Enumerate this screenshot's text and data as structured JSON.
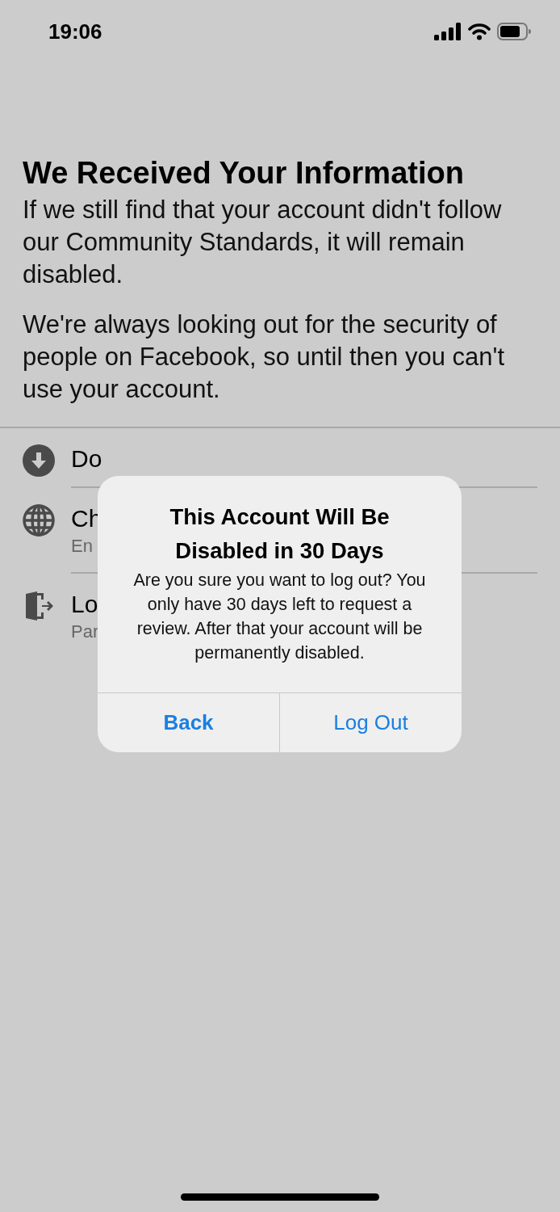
{
  "status_bar": {
    "time": "19:06"
  },
  "title": "We Received Your Information",
  "paragraphs": [
    "If we still find that your account didn't follow our Community Standards, it will remain disabled.",
    "We're always looking out for the security of people on Facebook, so until then you can't use your account."
  ],
  "options": [
    {
      "kind": "download",
      "label": "Do"
    },
    {
      "kind": "globe",
      "label": "Ch",
      "sublabel": "En"
    },
    {
      "kind": "logout",
      "label": "Lo",
      "sublabel": "Par"
    }
  ],
  "alert": {
    "title": "This Account Will Be Disabled in 30 Days",
    "message": "Are you sure you want to log out? You only have 30 days left to request a review. After that your account will be permanently disabled.",
    "buttons": [
      {
        "label": "Back",
        "preferred": true
      },
      {
        "label": "Log Out",
        "preferred": false
      }
    ]
  }
}
